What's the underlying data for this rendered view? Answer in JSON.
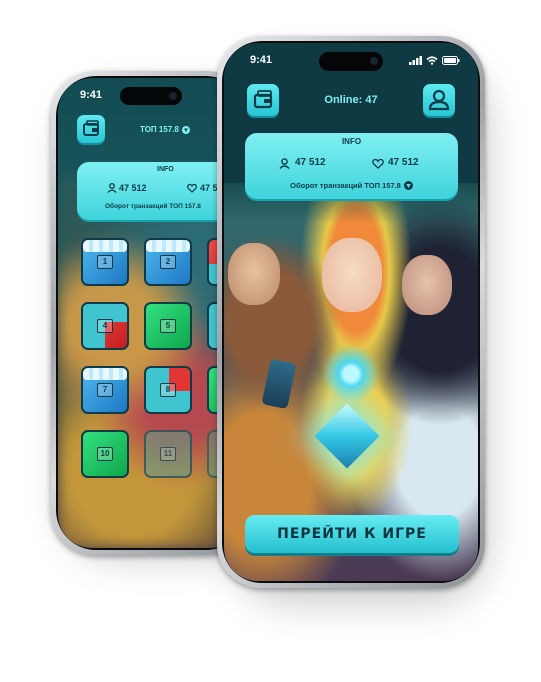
{
  "back_phone": {
    "status_time": "9:41",
    "top_label": "ТОП 157.8",
    "info": {
      "title": "INFO",
      "users": "47 512",
      "likes": "47 5",
      "turnover": "Оборот транзакций ТОП 157.8"
    },
    "tiles": [
      {
        "label": "1",
        "color": "blue",
        "ice": true
      },
      {
        "label": "2",
        "color": "blue",
        "ice": true
      },
      {
        "label": "",
        "color": "red-partial",
        "ice": false
      },
      {
        "label": "4",
        "color": "red-blue",
        "ice": false
      },
      {
        "label": "5",
        "color": "green",
        "ice": false
      },
      {
        "label": "",
        "color": "blue-partial",
        "ice": false
      },
      {
        "label": "7",
        "color": "blue",
        "ice": true
      },
      {
        "label": "8",
        "color": "blue-red",
        "ice": false
      },
      {
        "label": "",
        "color": "green-partial",
        "ice": false
      },
      {
        "label": "10",
        "color": "green",
        "ice": false
      },
      {
        "label": "11",
        "color": "faded",
        "ice": false
      },
      {
        "label": "",
        "color": "faded-partial",
        "ice": false
      }
    ]
  },
  "front_phone": {
    "status_time": "9:41",
    "online_label": "Online: 47",
    "info": {
      "title": "INFO",
      "users": "47 512",
      "likes": "47 512",
      "turnover": "Оборот транзакций ТОП 157.8"
    },
    "play_button": "ПЕРЕЙТИ К ИГРЕ"
  },
  "colors": {
    "accent": "#3fd3dc",
    "dark_text": "#0e3b47",
    "screen_bg": "#0f3a43"
  },
  "icons": [
    "wallet-icon",
    "profile-icon",
    "user-icon",
    "heart-icon",
    "ton-coin-icon",
    "signal-icon",
    "wifi-icon",
    "battery-icon"
  ]
}
